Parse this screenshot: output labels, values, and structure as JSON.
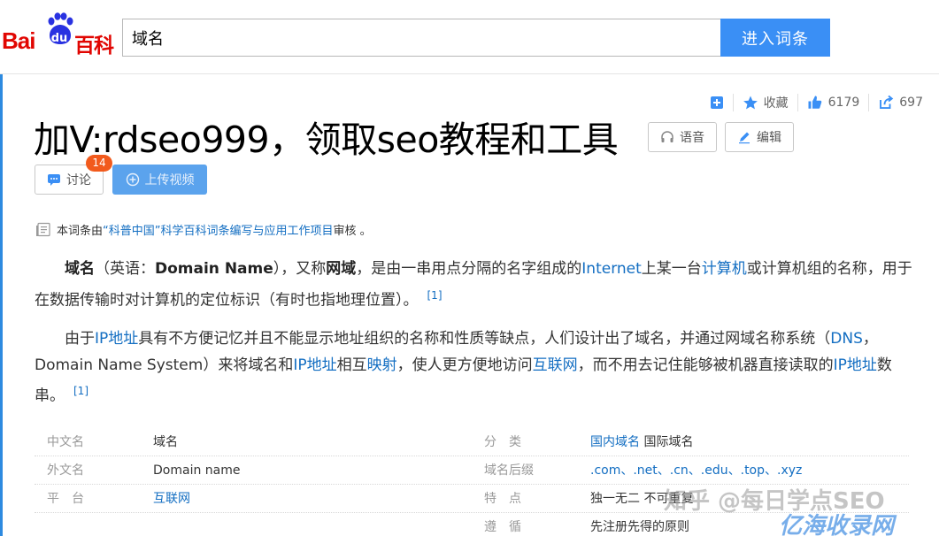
{
  "header": {
    "logo_bai": "Bai",
    "logo_du": "du",
    "logo_baike": "百科",
    "search_value": "域名",
    "search_button": "进入词条"
  },
  "tools": {
    "favorite_label": "收藏",
    "like_count": "6179",
    "share_count": "697"
  },
  "article": {
    "title": "加V:rdseo999，领取seo教程和工具",
    "voice_label": "语音",
    "edit_label": "编辑",
    "discuss_label": "讨论",
    "discuss_badge": "14",
    "upload_label": "上传视频"
  },
  "review": {
    "prefix": "本词条由",
    "org": "“科普中国”科学百科词条编写与应用工作项目",
    "suffix": " 审核 。"
  },
  "paragraphs": {
    "p1": {
      "term": "域名",
      "a": "（英语：",
      "en": "Domain Name",
      "b": "），又称",
      "alias": "网域",
      "c": "，是由一串用点分隔的名字组成的",
      "link_internet": "Internet",
      "d": "上某一台",
      "link_computer": "计算机",
      "e": "或计算机组的名称，用于在数据传输时对计算机的定位标识（有时也指地理位置）。",
      "ref": "[1]"
    },
    "p2": {
      "a": "由于",
      "link_ip": "IP地址",
      "b": "具有不方便记忆并且不能显示地址组织的名称和性质等缺点，人们设计出了域名，并通过网域名称系统（",
      "link_dns": "DNS",
      "c": "，Domain Name System）来将域名和",
      "link_ip2": "IP地址",
      "d": "相互",
      "link_map": "映射",
      "e": "，使人更方便地访问",
      "link_internet": "互联网",
      "f": "，而不用去记住能够被机器直接读取的",
      "link_ip3": "IP地址",
      "g": "数串。",
      "ref": "[1]"
    }
  },
  "info": {
    "rows": [
      {
        "l1": "中文名",
        "v1": "域名",
        "l2": "分　类",
        "v2_link": "国内域名",
        "v2": " 国际域名"
      },
      {
        "l1": "外文名",
        "v1": "Domain name",
        "l2": "域名后缀",
        "v2_link": ".com、.net、.cn、.edu、.top、.xyz",
        "v2": ""
      },
      {
        "l1": "平　台",
        "v1_link": "互联网",
        "l2": "特　点",
        "v2": "独一无二 不可重复"
      },
      {
        "l1": "",
        "v1": "",
        "l2": "遵　循",
        "v2": "先注册先得的原则"
      }
    ]
  },
  "watermark": {
    "line1": "知乎 @每日学点SEO",
    "line2": "亿海收录网"
  }
}
